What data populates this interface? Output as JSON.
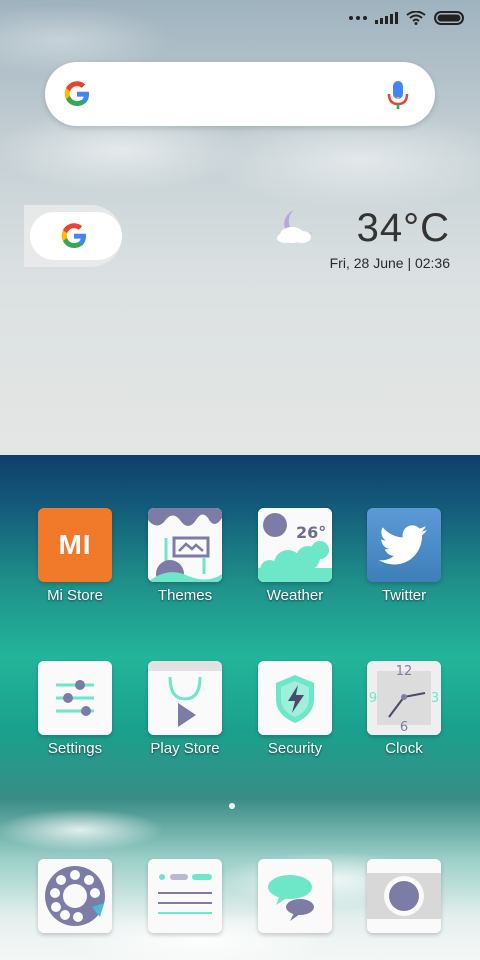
{
  "search": {
    "google_letter": "G"
  },
  "weather": {
    "temperature": "34°C",
    "date_time": "Fri, 28 June | 02:36"
  },
  "apps_row1": [
    {
      "label": "Mi Store",
      "icon": "mi-store-icon",
      "text_on_icon": "MI"
    },
    {
      "label": "Themes",
      "icon": "themes-icon"
    },
    {
      "label": "Weather",
      "icon": "weather-app-icon",
      "text_on_icon": "26°"
    },
    {
      "label": "Twitter",
      "icon": "twitter-bird-icon"
    }
  ],
  "apps_row2": [
    {
      "label": "Settings",
      "icon": "settings-sliders-icon"
    },
    {
      "label": "Play Store",
      "icon": "play-store-icon"
    },
    {
      "label": "Security",
      "icon": "security-shield-icon"
    },
    {
      "label": "Clock",
      "icon": "clock-icon",
      "clock_numbers": [
        "12",
        "3",
        "6",
        "9"
      ]
    }
  ],
  "dock": [
    {
      "icon": "phone-dialer-icon"
    },
    {
      "icon": "messaging-list-icon"
    },
    {
      "icon": "chat-bubbles-icon"
    },
    {
      "icon": "camera-icon"
    }
  ],
  "colors": {
    "accent_teal": "#6ee7c8",
    "accent_purple": "#7c7ca6",
    "mi_orange": "#f07a2a",
    "twitter_blue": "#4a8fc9"
  },
  "pages": {
    "count": 2,
    "active": 1
  }
}
